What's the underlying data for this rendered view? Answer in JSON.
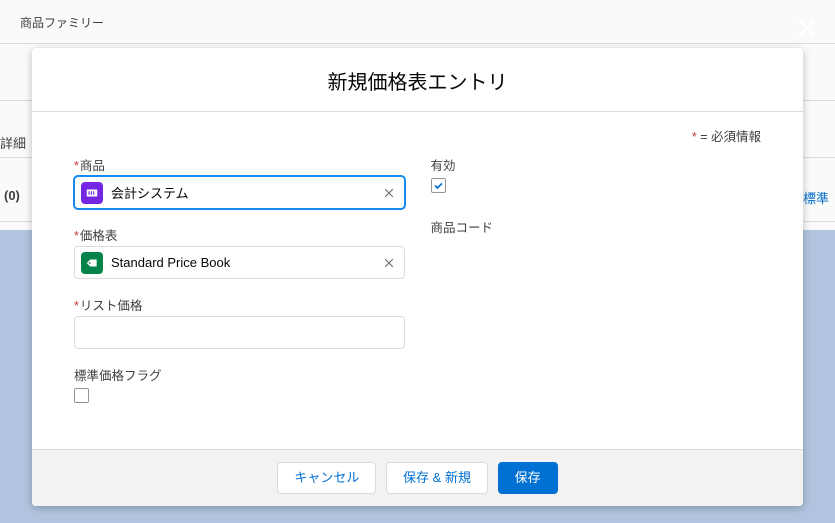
{
  "background": {
    "productFamily": "商品ファミリー",
    "detailTab": "詳細",
    "countBadge": "(0)",
    "standardLink": "標準"
  },
  "modal": {
    "title": "新規価格表エントリ",
    "requiredPrefix": "*",
    "requiredText": " = 必須情報",
    "fields": {
      "product": {
        "label": "商品",
        "value": "会計システム"
      },
      "pricebook": {
        "label": "価格表",
        "value": "Standard Price Book"
      },
      "listPrice": {
        "label": "リスト価格",
        "value": ""
      },
      "standardPriceFlag": {
        "label": "標準価格フラグ"
      },
      "active": {
        "label": "有効"
      },
      "productCode": {
        "label": "商品コード"
      }
    },
    "buttons": {
      "cancel": "キャンセル",
      "saveNew": "保存 & 新規",
      "save": "保存"
    }
  }
}
